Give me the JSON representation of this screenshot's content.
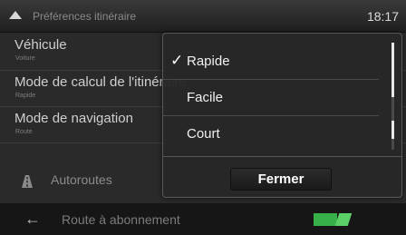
{
  "header": {
    "title": "Préférences itinéraire",
    "clock": "18:17"
  },
  "list": {
    "items": [
      {
        "label": "Véhicule",
        "value": "Voiture"
      },
      {
        "label": "Mode de calcul de l'itinéraire",
        "value": "Rapide"
      },
      {
        "label": "Mode de navigation",
        "value": "Route"
      }
    ],
    "autoroutes_label": "Autoroutes",
    "footer_label": "Route à abonnement"
  },
  "popup": {
    "options": [
      {
        "label": "Rapide",
        "checked": true
      },
      {
        "label": "Facile",
        "checked": false
      },
      {
        "label": "Court",
        "checked": false
      }
    ],
    "close_label": "Fermer"
  },
  "toggle": {
    "state": "on",
    "color": "#37b04a"
  }
}
